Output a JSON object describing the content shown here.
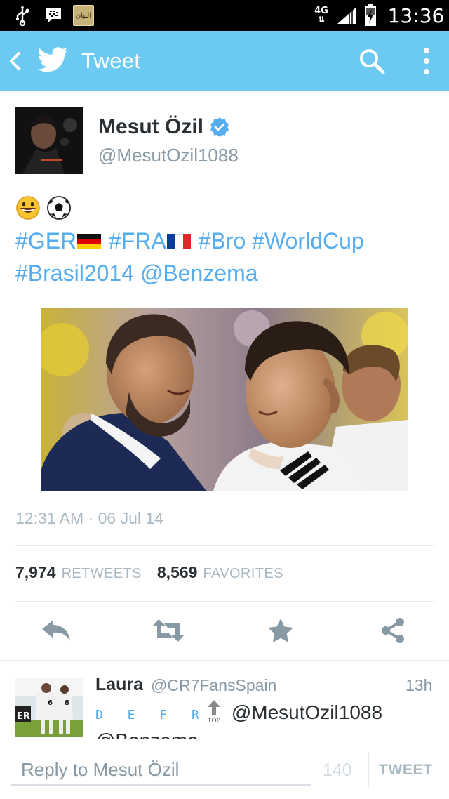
{
  "status_bar": {
    "network": "4G",
    "network_arrows": "⇅",
    "time": "13:36",
    "notification_icons": [
      "usb-icon",
      "bbm-icon",
      "news-app-icon"
    ],
    "news_app_label": "البيان"
  },
  "action_bar": {
    "title": "Tweet",
    "background_color": "#6ccaf2"
  },
  "tweet": {
    "author": {
      "name": "Mesut Özil",
      "handle": "@MesutOzil1088",
      "verified": true
    },
    "emojis": [
      "grinning-face-emoji",
      "soccer-ball-emoji"
    ],
    "text": {
      "h1": "#GER",
      "h2": "#FRA",
      "h3": "#Bro",
      "h4": "#WorldCup",
      "h5": "#Brasil2014",
      "mention": "@Benzema"
    },
    "timestamp": "12:31 AM · 06 Jul 14",
    "stats": {
      "retweets_count": "7,974",
      "retweets_label": "RETWEETS",
      "favorites_count": "8,569",
      "favorites_label": "FAVORITES"
    },
    "actions": [
      "reply-icon",
      "retweet-icon",
      "favorite-icon",
      "share-icon"
    ]
  },
  "reply": {
    "name": "Laura",
    "handle": "@CR7FansSpain",
    "time": "13h",
    "defr": "D E F R",
    "top_label": "TOP",
    "mention_1": "@MesutOzil1088",
    "mention_2": "@Benzema"
  },
  "compose": {
    "placeholder": "Reply to Mesut Özil",
    "counter": "140",
    "button_label": "TWEET"
  },
  "colors": {
    "accent": "#55acee",
    "action_bar": "#6ccaf2",
    "muted": "#8899a6",
    "light_muted": "#aab8c2",
    "icon_gray": "#8899a6"
  }
}
